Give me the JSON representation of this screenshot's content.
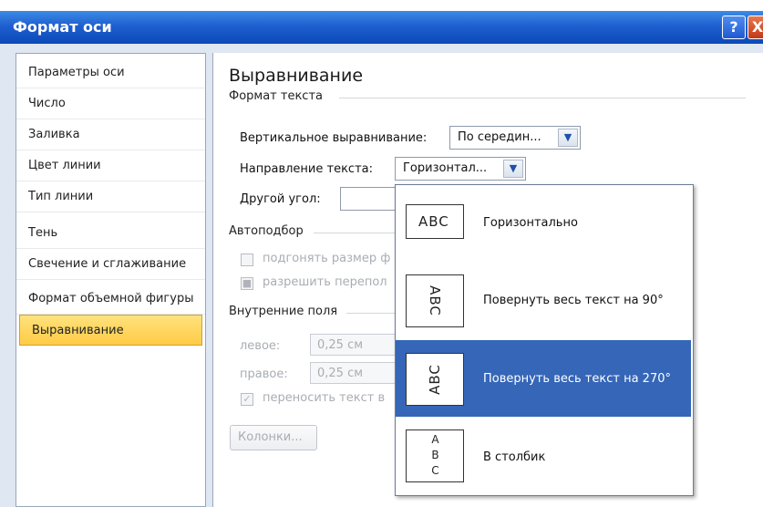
{
  "window": {
    "title": "Формат оси",
    "help_label": "?",
    "close_label": "X"
  },
  "sidebar": {
    "items": [
      {
        "label": "Параметры оси"
      },
      {
        "label": "Число"
      },
      {
        "label": "Заливка"
      },
      {
        "label": "Цвет линии"
      },
      {
        "label": "Тип линии"
      },
      {
        "label": "Тень"
      },
      {
        "label": "Свечение и сглаживание"
      },
      {
        "label": "Формат объемной фигуры"
      },
      {
        "label": "Выравнивание"
      }
    ],
    "active": "Выравнивание"
  },
  "main": {
    "heading": "Выравнивание",
    "text_format": {
      "group_label": "Формат текста",
      "vertical_align_label": "Вертикальное выравнивание:",
      "vertical_align_value": "По середин...",
      "text_direction_label": "Направление текста:",
      "text_direction_value": "Горизонтал...",
      "other_angle_label": "Другой угол:"
    },
    "autofit": {
      "group_label": "Автоподбор",
      "resize_shape_label": "подгонять размер ф",
      "allow_overflow_label": "разрешить перепол"
    },
    "internal_margins": {
      "group_label": "Внутренние поля",
      "left_label": "левое:",
      "left_value": "0,25 см",
      "right_label": "правое:",
      "right_value": "0,25 см",
      "wrap_label": "переносить текст в",
      "columns_button": "Колонки..."
    }
  },
  "dropdown": {
    "options": [
      {
        "icon_text": "ABC",
        "label": "Горизонтально"
      },
      {
        "icon_text": "ABC",
        "label": "Повернуть весь текст на 90°"
      },
      {
        "icon_text": "ABC",
        "label": "Повернуть весь текст на 270°"
      },
      {
        "icon_text": "A B C",
        "label": "В столбик"
      }
    ],
    "highlighted": "Повернуть весь текст на 270°"
  },
  "colors": {
    "titlebar": "#1f5fcf",
    "active_nav": "#ffcb45",
    "dropdown_highlight": "#3566b8"
  }
}
